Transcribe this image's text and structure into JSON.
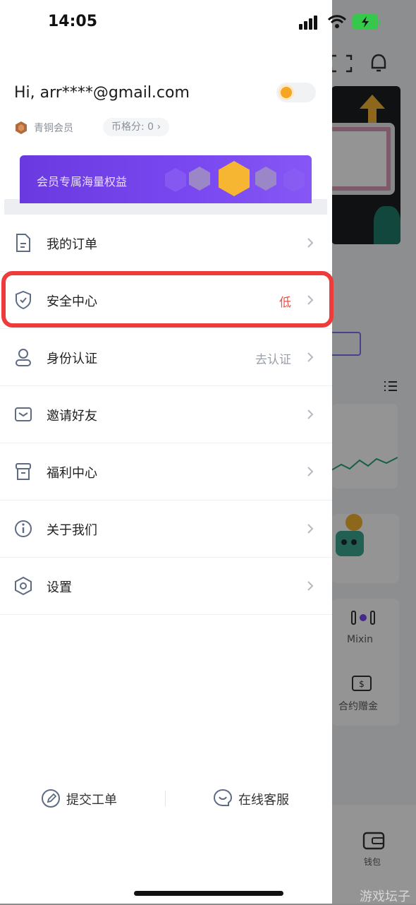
{
  "status_bar": {
    "time": "14:05"
  },
  "header": {
    "greeting": "Hi, arr****@gmail.com",
    "member_level": "青铜会员",
    "score": "币格分: 0 ›"
  },
  "vip_banner": {
    "text": "会员专属海量权益"
  },
  "menu": {
    "items": [
      {
        "label": "我的订单",
        "value": "",
        "icon": "document-icon"
      },
      {
        "label": "安全中心",
        "value": "低",
        "icon": "shield-icon"
      },
      {
        "label": "身份认证",
        "value": "去认证",
        "icon": "user-icon"
      },
      {
        "label": "邀请好友",
        "value": "",
        "icon": "envelope-icon"
      },
      {
        "label": "福利中心",
        "value": "",
        "icon": "gift-icon"
      },
      {
        "label": "关于我们",
        "value": "",
        "icon": "info-icon"
      },
      {
        "label": "设置",
        "value": "",
        "icon": "settings-icon"
      }
    ]
  },
  "footer": {
    "submit_ticket": "提交工单",
    "online_support": "在线客服"
  },
  "background": {
    "mixin_label": "Mixin",
    "contract_bonus_label": "合约赠金",
    "wallet_label": "钱包"
  },
  "watermark": "游戏坛子",
  "colors": {
    "accent_purple": "#7a48f0",
    "security_low": "#e8534a",
    "highlight_box": "#ee3b3b",
    "battery_green": "#35c84a"
  }
}
